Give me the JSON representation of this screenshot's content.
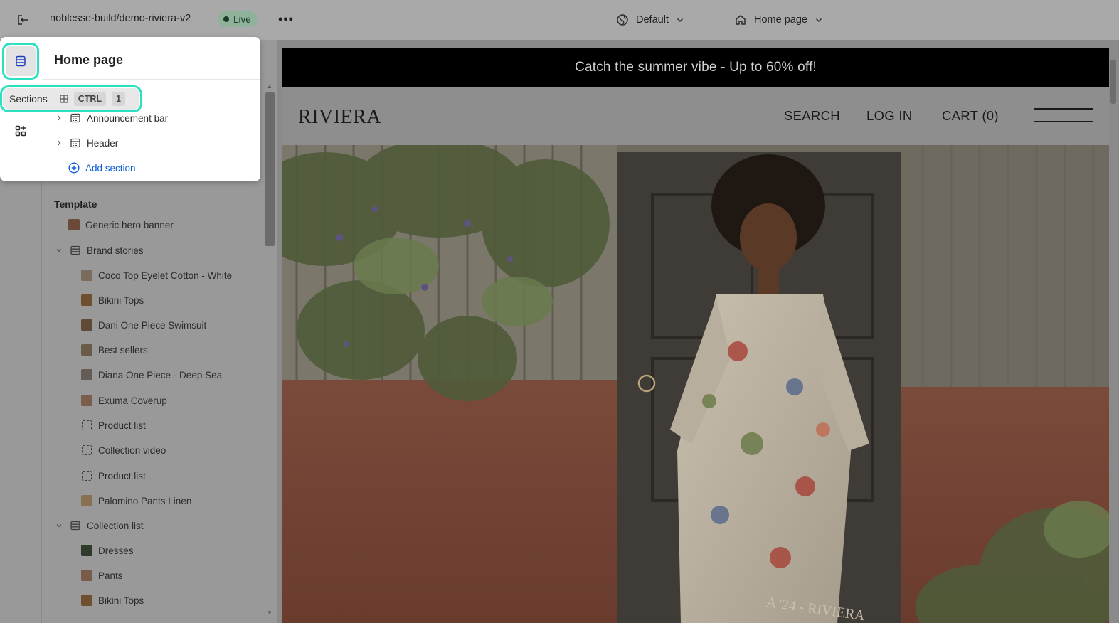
{
  "topbar": {
    "store_name": "noblesse-build/demo-riviera-v2",
    "status_badge": "Live",
    "more_icon": "ellipsis-icon",
    "theme_label": "Default",
    "page_label": "Home page"
  },
  "sidebar": {
    "title": "Home page",
    "header_group": [
      {
        "label": "Announcement bar",
        "icon": "section-icon",
        "expandable": true
      },
      {
        "label": "Header",
        "icon": "section-icon",
        "expandable": true
      }
    ],
    "add_section_label": "Add section",
    "template_heading": "Template",
    "template_items": [
      {
        "label": "Generic hero banner",
        "icon": "image-thumb",
        "level": 0
      },
      {
        "label": "Brand stories",
        "icon": "section-icon",
        "level": 0,
        "expanded": true
      },
      {
        "label": "Coco Top Eyelet Cotton - White",
        "icon": "image-thumb",
        "level": 1
      },
      {
        "label": "Bikini Tops",
        "icon": "image-thumb",
        "level": 1
      },
      {
        "label": "Dani One Piece Swimsuit",
        "icon": "image-thumb",
        "level": 1
      },
      {
        "label": "Best sellers",
        "icon": "image-thumb",
        "level": 1
      },
      {
        "label": "Diana One Piece - Deep Sea",
        "icon": "image-thumb",
        "level": 1
      },
      {
        "label": "Exuma Coverup",
        "icon": "image-thumb",
        "level": 1
      },
      {
        "label": "Product list",
        "icon": "placeholder-icon",
        "level": 1
      },
      {
        "label": "Collection video",
        "icon": "placeholder-icon",
        "level": 1
      },
      {
        "label": "Product list",
        "icon": "placeholder-icon",
        "level": 1
      },
      {
        "label": "Palomino Pants Linen",
        "icon": "image-thumb",
        "level": 1
      },
      {
        "label": "Collection list",
        "icon": "section-icon",
        "level": 0,
        "expanded": true
      },
      {
        "label": "Dresses",
        "icon": "image-thumb",
        "level": 1
      },
      {
        "label": "Pants",
        "icon": "image-thumb",
        "level": 1
      },
      {
        "label": "Bikini Tops",
        "icon": "image-thumb",
        "level": 1
      }
    ]
  },
  "tooltip": {
    "label": "Sections",
    "key1": "CTRL",
    "key2": "1"
  },
  "preview": {
    "announcement": "Catch the summer vibe - Up to 60% off!",
    "logo": "RIVIERA",
    "nav": [
      "SEARCH",
      "LOG IN",
      "CART (0)"
    ],
    "hero_caption": "A '24 - RIVIERA"
  },
  "colors": {
    "highlight": "#2ee0c2",
    "live_badge": "#8fb29b",
    "link": "#0b5ad8"
  }
}
